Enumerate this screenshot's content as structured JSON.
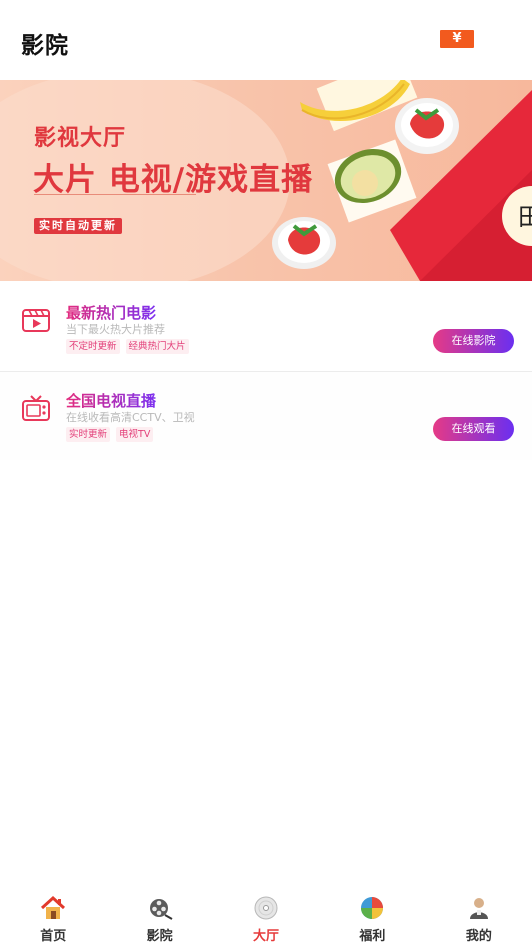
{
  "header": {
    "title": "影院",
    "coin_label": "¥"
  },
  "banner": {
    "line1": "影视大厅",
    "line2": "大片 电视/游戏直播",
    "tag": "实时自动更新",
    "envelope_text": "田"
  },
  "cards": [
    {
      "title": "最新热门电影",
      "subtitle": "当下最火热大片推荐",
      "tags": [
        "不定时更新",
        "经典热门大片"
      ],
      "button": "在线影院",
      "icon": "film-player-icon"
    },
    {
      "title": "全国电视直播",
      "subtitle": "在线收看高清CCTV、卫视",
      "tags": [
        "实时更新",
        "电视TV"
      ],
      "button": "在线观看",
      "icon": "tv-icon"
    }
  ],
  "nav": {
    "items": [
      {
        "label": "首页",
        "icon": "home-icon"
      },
      {
        "label": "影院",
        "icon": "film-reel-icon"
      },
      {
        "label": "大厅",
        "icon": "disc-icon",
        "active": true
      },
      {
        "label": "福利",
        "icon": "pie-chart-icon"
      },
      {
        "label": "我的",
        "icon": "user-icon"
      }
    ]
  },
  "colors": {
    "accent": "#e0383e",
    "gradient_start": "#e53a86",
    "gradient_end": "#6b2ff0",
    "coin": "#f25a1e"
  }
}
